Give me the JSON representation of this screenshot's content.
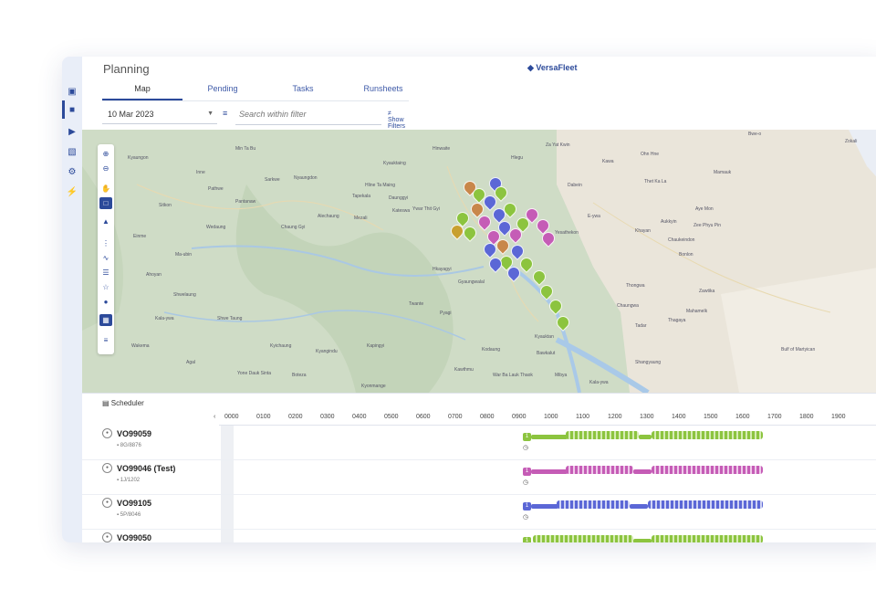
{
  "app": {
    "page_title": "Planning",
    "brand": "VersaFleet"
  },
  "tabs": [
    {
      "label": "Map",
      "active": true
    },
    {
      "label": "Pending",
      "active": false
    },
    {
      "label": "Tasks",
      "active": false
    },
    {
      "label": "Runsheets",
      "active": false
    }
  ],
  "toolbar": {
    "date": "10 Mar 2023",
    "search_placeholder": "Search within filter",
    "show_filters": "Show Filters"
  },
  "map": {
    "labels": [
      "Min Ta Bu",
      "Kyaungon",
      "Inne",
      "Pathwe",
      "Sitkon",
      "Pantanaw",
      "Sarkwe",
      "Nyaungdon",
      "Hpa Ye",
      "Kyauktaing",
      "Hinwaite",
      "Than Pyu Village",
      "Hlegu",
      "Za Yat Kwin",
      "Kawa",
      "Ohn Hne",
      "Mamauk",
      "Dabein",
      "Thet Ka La",
      "Aye Mon",
      "Zee Phyu Pin",
      "Chaukeindon",
      "Khayan",
      "Aukkyin",
      "E-ywa",
      "Bonlon",
      "Wedaung",
      "Chaung Gyi",
      "Alechaung",
      "Mezali",
      "Hmawbi",
      "Taikkyi",
      "Tapekala",
      "Kateswa",
      "Daunggyi",
      "Ywar Thit Gyi",
      "Hline Ta Maing",
      "Yesathekon",
      "Einme",
      "Ma-ubin",
      "Shwe Taung",
      "Kyichaung",
      "Kyangindu",
      "Kapingyi",
      "Dalla",
      "Kodaung",
      "Bawkalut",
      "Tadar",
      "Thagaya",
      "Mahamelk",
      "Zawtika",
      "Thongwa",
      "Chaungwa",
      "Bulf of Martyican",
      "Shangyaung",
      "Kala-ywa",
      "Mibya",
      "Kawthmu",
      "War Ba Lauk Thaok",
      "Kyonmange",
      "Boteza",
      "Yone Dauk Sinta",
      "Agal",
      "Wakema",
      "Kala-ywa",
      "Shwelaung",
      "Ahoyan",
      "Pyagi",
      "Twante",
      "Gyaungwalal",
      "Hkayagyi",
      "Thanbaling",
      "Kyauktan",
      "Bwe-o",
      "Zokali"
    ],
    "tool_icons": [
      "zoom-in",
      "zoom-out",
      "pan",
      "select",
      "pin",
      "column",
      "chart",
      "list",
      "tree",
      "drop",
      "grid",
      "list-2"
    ]
  },
  "scheduler": {
    "title": "Scheduler",
    "hours": [
      "0000",
      "0100",
      "0200",
      "0300",
      "0400",
      "0500",
      "0600",
      "0700",
      "0800",
      "0900",
      "1000",
      "1100",
      "1200",
      "1300",
      "1400",
      "1500",
      "1600",
      "1700",
      "1800",
      "1900"
    ],
    "rows": [
      {
        "id": "VO99059",
        "plate": "8G/8876",
        "color": "#8cc43f",
        "badge": "1"
      },
      {
        "id": "VO99046 (Test)",
        "plate": "1J/1202",
        "color": "#c55cb6",
        "badge": "1"
      },
      {
        "id": "VO99105",
        "plate": "5P/8046",
        "color": "#5b67d6",
        "badge": "1"
      },
      {
        "id": "VO99050",
        "plate": "",
        "color": "#8cc43f",
        "badge": "1"
      }
    ]
  },
  "colors": {
    "accent": "#2c4a9a",
    "map_land": "#cfdcc6",
    "route_green": "#8cc43f",
    "route_pink": "#c55cb6",
    "route_blue": "#5b67d6"
  }
}
